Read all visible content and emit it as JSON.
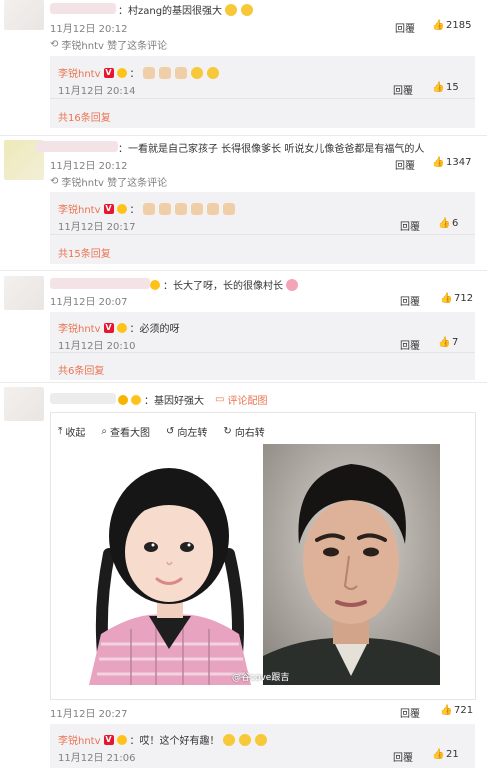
{
  "comments": [
    {
      "text": "：村zang的基因很强大",
      "time": "11月12日 20:12",
      "reply": "回覆",
      "likes": "2185",
      "liked_by": "李锐hntv 赞了这条评论",
      "sub": {
        "name": "李锐hntv",
        "time": "11月12日 20:14",
        "reply": "回覆",
        "likes": "15",
        "emojis": [
          "clap",
          "clap",
          "clap",
          "thumb",
          "thumb"
        ]
      },
      "more": "共16条回复"
    },
    {
      "text": "：一看就是自己家孩子 长得很像爹长 听说女儿像爸爸都是有福气的人",
      "time": "11月12日 20:12",
      "reply": "回覆",
      "likes": "1347",
      "liked_by": "李锐hntv 赞了这条评论",
      "sub": {
        "name": "李锐hntv",
        "time": "11月12日 20:17",
        "reply": "回覆",
        "likes": "6",
        "emojis": [
          "clap",
          "clap",
          "clap",
          "clap",
          "clap",
          "clap"
        ]
      },
      "more": "共15条回复"
    },
    {
      "text": "：长大了呀，长的很像村长",
      "time": "11月12日 20:07",
      "reply": "回覆",
      "likes": "712",
      "sub": {
        "name": "李锐hntv",
        "time": "11月12日 20:10",
        "reply": "回覆",
        "likes": "7",
        "text": "：必须的呀"
      },
      "more": "共6条回复"
    },
    {
      "text": "：基因好强大",
      "pic_link": "评论配图",
      "time": "11月12日 20:27",
      "reply": "回覆",
      "likes": "721",
      "toolbar": [
        "收起",
        "查看大图",
        "向左转",
        "向右转"
      ],
      "watermark": "@谷cove跟吉",
      "sub": {
        "name": "李锐hntv",
        "time": "11月12日 21:06",
        "reply": "回覆",
        "likes": "21",
        "text": "：哎！这个好有趣！",
        "emojis": [
          "thumb",
          "thumb",
          "thumb"
        ]
      }
    }
  ],
  "colors": {
    "link": "#eb7350",
    "subbox": "#f2f2f5",
    "text": "#333333",
    "meta": "#808080"
  }
}
